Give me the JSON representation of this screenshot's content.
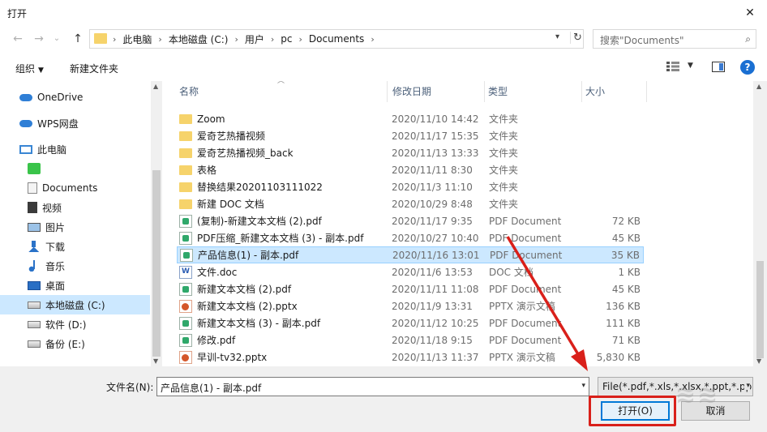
{
  "window": {
    "title": "打开",
    "close_glyph": "✕"
  },
  "nav": {
    "back_glyph": "←",
    "forward_glyph": "→",
    "dropdown_glyph": "⌄",
    "up_glyph": "↑",
    "breadcrumbs": [
      "此电脑",
      "本地磁盘 (C:)",
      "用户",
      "pc",
      "Documents"
    ],
    "separator": "›",
    "search_placeholder": "搜索\"Documents\""
  },
  "toolbar": {
    "organize_label": "组织",
    "new_folder_label": "新建文件夹",
    "help_label": "?"
  },
  "sidebar": {
    "items": [
      {
        "label": "OneDrive",
        "icon": "cloud-icon"
      },
      {
        "label": "WPS网盘",
        "icon": "wps-cloud-icon"
      },
      {
        "label": "此电脑",
        "icon": "computer-icon"
      },
      {
        "label": "",
        "icon": "wechat-icon"
      },
      {
        "label": "Documents",
        "icon": "documents-icon"
      },
      {
        "label": "视频",
        "icon": "video-icon"
      },
      {
        "label": "图片",
        "icon": "pictures-icon"
      },
      {
        "label": "下载",
        "icon": "download-icon"
      },
      {
        "label": "音乐",
        "icon": "music-icon"
      },
      {
        "label": "桌面",
        "icon": "desktop-icon"
      },
      {
        "label": "本地磁盘 (C:)",
        "icon": "drive-icon",
        "selected": true
      },
      {
        "label": "软件 (D:)",
        "icon": "drive-icon"
      },
      {
        "label": "备份 (E:)",
        "icon": "drive-icon"
      }
    ]
  },
  "columns": {
    "name": "名称",
    "date": "修改日期",
    "type": "类型",
    "size": "大小"
  },
  "files": [
    {
      "name": "Zoom",
      "date": "2020/11/10 14:42",
      "type": "文件夹",
      "size": "",
      "kind": "folder"
    },
    {
      "name": "爱奇艺热播视频",
      "date": "2020/11/17 15:35",
      "type": "文件夹",
      "size": "",
      "kind": "folder"
    },
    {
      "name": "爱奇艺热播视频_back",
      "date": "2020/11/13 13:33",
      "type": "文件夹",
      "size": "",
      "kind": "folder"
    },
    {
      "name": "表格",
      "date": "2020/11/11 8:30",
      "type": "文件夹",
      "size": "",
      "kind": "folder"
    },
    {
      "name": "替换结果20201103111022",
      "date": "2020/11/3 11:10",
      "type": "文件夹",
      "size": "",
      "kind": "folder"
    },
    {
      "name": "新建 DOC 文档",
      "date": "2020/10/29 8:48",
      "type": "文件夹",
      "size": "",
      "kind": "folder"
    },
    {
      "name": "(复制)-新建文本文档 (2).pdf",
      "date": "2020/11/17 9:35",
      "type": "PDF Document",
      "size": "72 KB",
      "kind": "pdf"
    },
    {
      "name": "PDF压缩_新建文本文档 (3) - 副本.pdf",
      "date": "2020/10/27 10:40",
      "type": "PDF Document",
      "size": "45 KB",
      "kind": "pdf"
    },
    {
      "name": "产品信息(1) - 副本.pdf",
      "date": "2020/11/16 13:01",
      "type": "PDF Document",
      "size": "35 KB",
      "kind": "pdf",
      "selected": true
    },
    {
      "name": "文件.doc",
      "date": "2020/11/6 13:53",
      "type": "DOC 文档",
      "size": "1 KB",
      "kind": "doc"
    },
    {
      "name": "新建文本文档 (2).pdf",
      "date": "2020/11/11 11:08",
      "type": "PDF Document",
      "size": "45 KB",
      "kind": "pdf"
    },
    {
      "name": "新建文本文档 (2).pptx",
      "date": "2020/11/9 13:31",
      "type": "PPTX 演示文稿",
      "size": "136 KB",
      "kind": "ppt"
    },
    {
      "name": "新建文本文档 (3) - 副本.pdf",
      "date": "2020/11/12 10:25",
      "type": "PDF Document",
      "size": "111 KB",
      "kind": "pdf"
    },
    {
      "name": "修改.pdf",
      "date": "2020/11/18 9:15",
      "type": "PDF Document",
      "size": "71 KB",
      "kind": "pdf"
    },
    {
      "name": "早训-tv32.pptx",
      "date": "2020/11/13 11:37",
      "type": "PPTX 演示文稿",
      "size": "5,830 KB",
      "kind": "ppt"
    }
  ],
  "footer": {
    "filename_label": "文件名(N):",
    "filename_value": "产品信息(1) - 副本.pdf",
    "filetype_value": "File(*.pdf,*.xls,*.xlsx,*.ppt,*.pp",
    "open_label": "打开(O)",
    "cancel_label": "取消"
  },
  "colors": {
    "selection": "#cce8ff",
    "accent": "#0078d7",
    "annotation": "#d9201a",
    "folder": "#f6d36b"
  }
}
